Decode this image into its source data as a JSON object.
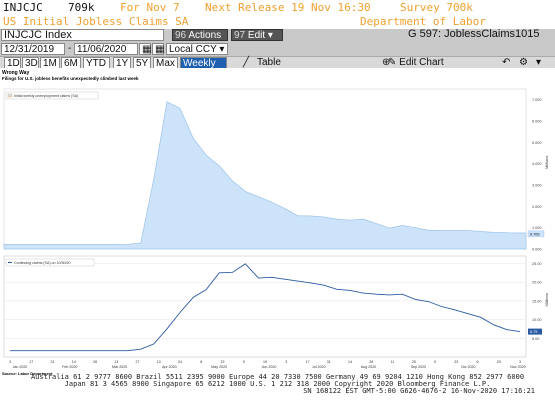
{
  "header": {
    "ticker": "INJCJC",
    "value": "709k",
    "for_label": "For Nov 7",
    "next_release": "Next Release 19 Nov 16:30",
    "survey": "Survey 700k",
    "subtitle": "US Initial Jobless Claims SA",
    "department": "Department of Labor"
  },
  "toolbar": {
    "security": "INJCJC Index",
    "actions_num": "96",
    "actions": "Actions",
    "edit_num": "97",
    "edit": "Edit",
    "page_code": "G 597: JoblessClaims1015",
    "start_date": "12/31/2019",
    "end_date": "11/06/2020",
    "currency": "Local CCY",
    "periods": [
      "1D",
      "3D",
      "1M",
      "6M",
      "YTD",
      "1Y",
      "5Y",
      "Max"
    ],
    "frequency": "Weekly",
    "table_label": "Table",
    "edit_chart": "Edit Chart"
  },
  "chart_data": [
    {
      "type": "area",
      "title": "Wrong Way",
      "subtitle": "Filings for U.S. jobless benefits unexpectedly climbed last week",
      "series": [
        {
          "name": "Initial weekly unemployment claims (SA)",
          "values": [
            0.21,
            0.21,
            0.21,
            0.21,
            0.21,
            0.21,
            0.21,
            0.21,
            0.21,
            0.22,
            0.28,
            3.3,
            6.9,
            6.6,
            5.2,
            4.4,
            3.9,
            3.2,
            2.7,
            2.45,
            2.2,
            1.9,
            1.56,
            1.55,
            1.5,
            1.4,
            1.35,
            1.4,
            1.2,
            0.98,
            1.1,
            1.0,
            0.88,
            0.87,
            0.87,
            0.87,
            0.82,
            0.78,
            0.76,
            0.75
          ]
        }
      ],
      "ylim": [
        0,
        7.5
      ],
      "ylabel": "Millions",
      "yticks": [
        "7.000",
        "6.000",
        "5.000",
        "4.000",
        "3.000",
        "2.000",
        "1.000",
        "0.000"
      ],
      "last_label": "0.709"
    },
    {
      "type": "line",
      "series": [
        {
          "name": "Continuing claims (SA) on 10/30/20",
          "values": [
            1.7,
            1.7,
            1.7,
            1.7,
            1.7,
            1.7,
            1.7,
            1.7,
            1.7,
            1.7,
            2.1,
            3.5,
            7.5,
            11.9,
            15.9,
            18.0,
            22.5,
            22.6,
            24.9,
            21.1,
            21.3,
            20.8,
            20.3,
            19.8,
            19.2,
            18.1,
            17.8,
            17.1,
            16.8,
            16.6,
            16.8,
            15.4,
            14.8,
            13.5,
            12.6,
            11.6,
            10.6,
            8.6,
            7.3,
            6.8
          ]
        }
      ],
      "ylim": [
        0,
        27
      ],
      "ylabel": "Millions",
      "yticks": [
        "25.00",
        "20.00",
        "15.00",
        "10.00",
        "5.00"
      ],
      "last_label": "6.79"
    }
  ],
  "x_axis": {
    "day_ticks": [
      "3",
      "17",
      "31",
      "14",
      "28",
      "13",
      "27",
      "10",
      "24",
      "8",
      "22",
      "5",
      "19",
      "3",
      "17",
      "31",
      "14",
      "28",
      "11",
      "25",
      "9",
      "23",
      "6",
      "20",
      "3"
    ],
    "month_labels": [
      "Jan 2020",
      "Feb 2020",
      "Mar 2020",
      "Apr 2020",
      "May 2020",
      "Jun 2020",
      "Jul 2020",
      "Aug 2020",
      "Sep 2020",
      "Oct 2020",
      "Nov 2020"
    ]
  },
  "source": "Source: Labor Department",
  "footer": {
    "line1": "Australia 61 2 9777 8600 Brazil 5511 2395 9000 Europe 44 20 7330 7500 Germany 49 69 9204 1210 Hong Kong 852 2977 6000",
    "line2": "Japan 81 3 4565 8900    Singapore 65 6212 1000    U.S. 1 212 318 2000    Copyright 2020 Bloomberg Finance L.P.",
    "line3": "SN 168122 EST  GMT-5:00 G626-4676-2 16-Nov-2020 17:16:21"
  },
  "colors": {
    "accent": "#f0a030",
    "area_fill": "#cce3fa",
    "area_line": "#9cc3e8",
    "line": "#2a5aa0"
  }
}
